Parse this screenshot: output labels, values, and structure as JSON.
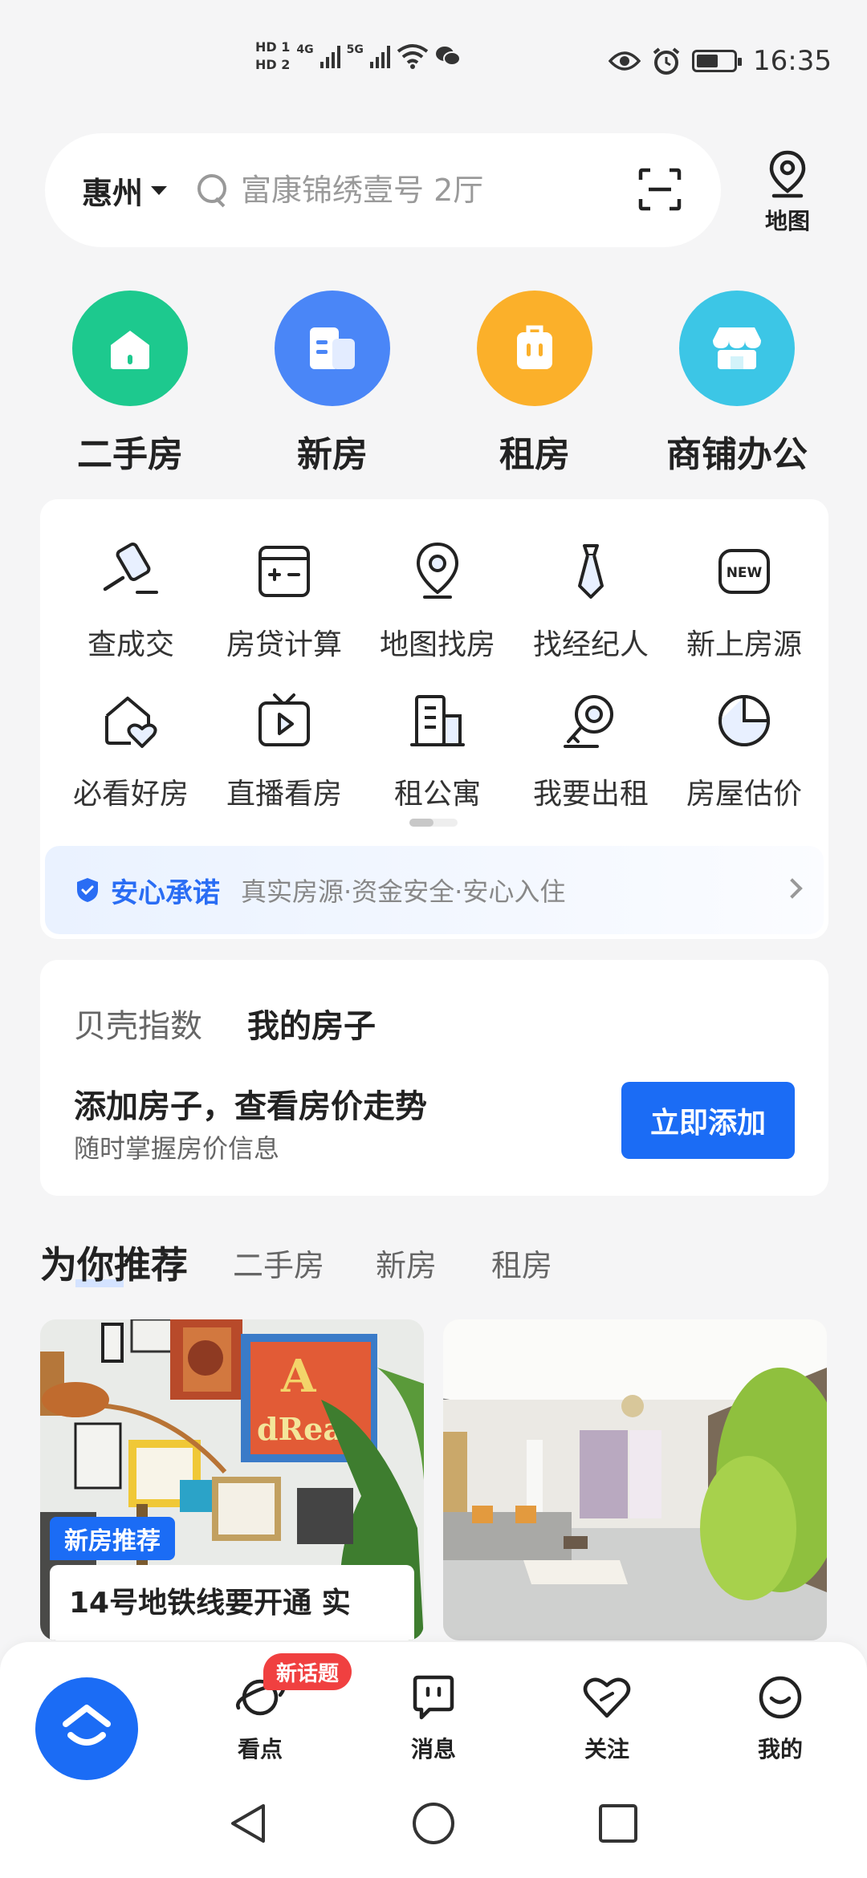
{
  "status_bar": {
    "hd1": "HD 1",
    "hd2": "HD 2",
    "net1": "4G",
    "net2": "5G",
    "time": "16:35"
  },
  "search": {
    "city": "惠州",
    "placeholder": "富康锦绣壹号 2厅",
    "map_label": "地图"
  },
  "big_categories": [
    {
      "label": "二手房",
      "color": "#1dc98e",
      "icon": "home-icon"
    },
    {
      "label": "新房",
      "color": "#4a86f7",
      "icon": "building-icon"
    },
    {
      "label": "租房",
      "color": "#fbb02a",
      "icon": "suitcase-icon"
    },
    {
      "label": "商铺办公",
      "color": "#3cc6e6",
      "icon": "shop-icon"
    }
  ],
  "tools": [
    {
      "label": "查成交",
      "icon": "gavel-icon"
    },
    {
      "label": "房贷计算",
      "icon": "calculator-icon"
    },
    {
      "label": "地图找房",
      "icon": "map-pin-icon"
    },
    {
      "label": "找经纪人",
      "icon": "agent-tie-icon"
    },
    {
      "label": "新上房源",
      "icon": "new-badge-icon",
      "badge": "NEW"
    },
    {
      "label": "必看好房",
      "icon": "heart-house-icon"
    },
    {
      "label": "直播看房",
      "icon": "tv-play-icon"
    },
    {
      "label": "租公寓",
      "icon": "apartment-icon"
    },
    {
      "label": "我要出租",
      "icon": "key-icon"
    },
    {
      "label": "房屋估价",
      "icon": "pie-chart-icon"
    }
  ],
  "promise": {
    "title": "安心承诺",
    "desc": "真实房源·资金安全·安心入住"
  },
  "my_house": {
    "tab1": "贝壳指数",
    "tab2": "我的房子",
    "title": "添加房子，查看房价走势",
    "subtitle": "随时掌握房价信息",
    "button": "立即添加"
  },
  "recommend": {
    "title": "为你推荐",
    "tabs": [
      "二手房",
      "新房",
      "租房"
    ]
  },
  "feed": {
    "badge": "新房推荐",
    "title_line1": "14号地铁线要开通 实"
  },
  "bottom_nav": {
    "new_topic_badge": "新话题",
    "items": [
      {
        "label": "看点",
        "icon": "planet-icon"
      },
      {
        "label": "消息",
        "icon": "message-icon"
      },
      {
        "label": "关注",
        "icon": "heart-icon"
      },
      {
        "label": "我的",
        "icon": "smile-icon"
      }
    ]
  },
  "colors": {
    "accent": "#1b6cf5",
    "badge_red": "#f04040",
    "background": "#f5f5f6"
  }
}
